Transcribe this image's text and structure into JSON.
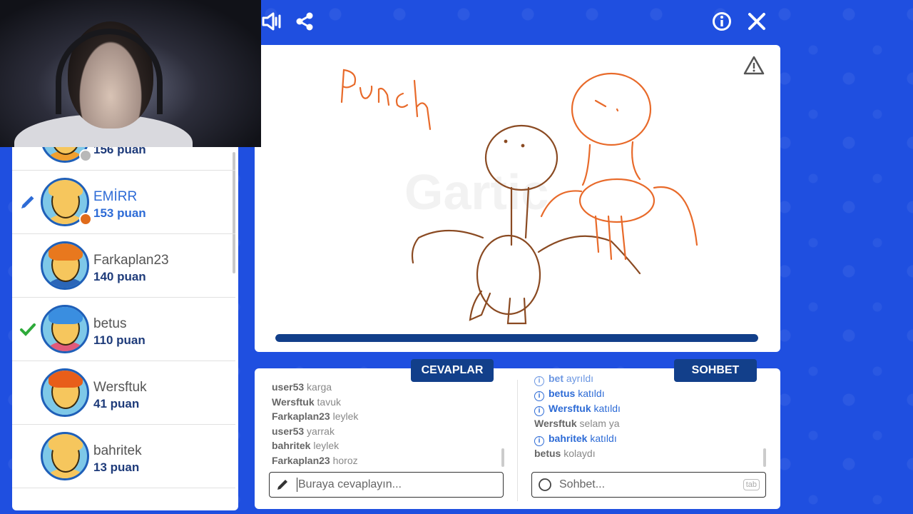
{
  "players": [
    {
      "name": "",
      "score": "156 puan",
      "status_color": "#b8b8b8",
      "mark": "",
      "hair": "#f7a823",
      "shirt": "#f0a030"
    },
    {
      "name": "EMİRR",
      "score": "153 puan",
      "status_color": "#e06b1a",
      "mark": "pencil",
      "drawing": true,
      "hair": "#f6c65d",
      "shirt": "#f6c65d"
    },
    {
      "name": "Farkaplan23",
      "score": "140 puan",
      "status_color": "",
      "mark": "",
      "hair": "#e8781e",
      "shirt": "#2b66b8"
    },
    {
      "name": "betus",
      "score": "110 puan",
      "status_color": "",
      "mark": "check",
      "hair": "#3a8ee0",
      "shirt": "#e15a7a"
    },
    {
      "name": "Wersftuk",
      "score": "41 puan",
      "status_color": "",
      "mark": "",
      "hair": "#e85e1a",
      "shirt": "#7ec8e8"
    },
    {
      "name": "bahritek",
      "score": "13 puan",
      "status_color": "",
      "mark": "",
      "hair": "#f6c65d",
      "shirt": "#f6c65d"
    }
  ],
  "canvas": {
    "drawing_text": "Punch",
    "progress_fraction": 1.0
  },
  "answers": {
    "tab_label": "CEVAPLAR",
    "messages": [
      {
        "user": "user53",
        "text": "karga"
      },
      {
        "user": "Wersftuk",
        "text": "tavuk"
      },
      {
        "user": "Farkaplan23",
        "text": "leylek"
      },
      {
        "user": "user53",
        "text": "yarrak"
      },
      {
        "user": "bahritek",
        "text": "leylek"
      },
      {
        "user": "Farkaplan23",
        "text": "horoz"
      }
    ],
    "placeholder": "Buraya cevaplayın..."
  },
  "chat": {
    "tab_label": "SOHBET",
    "messages": [
      {
        "type": "info",
        "user": "bet",
        "text": "ayrıldı"
      },
      {
        "type": "info",
        "user": "betus",
        "text": "katıldı"
      },
      {
        "type": "info",
        "user": "Wersftuk",
        "text": "katıldı"
      },
      {
        "type": "msg",
        "user": "Wersftuk",
        "text": "selam ya"
      },
      {
        "type": "info",
        "user": "bahritek",
        "text": "katıldı"
      },
      {
        "type": "msg",
        "user": "betus",
        "text": "kolaydı"
      }
    ],
    "placeholder": "Sohbet...",
    "tab_hint": "tab"
  },
  "icons": [
    "volume-icon",
    "share-icon",
    "info-icon",
    "close-icon",
    "warning-icon",
    "pencil-icon",
    "check-icon",
    "search-icon"
  ]
}
